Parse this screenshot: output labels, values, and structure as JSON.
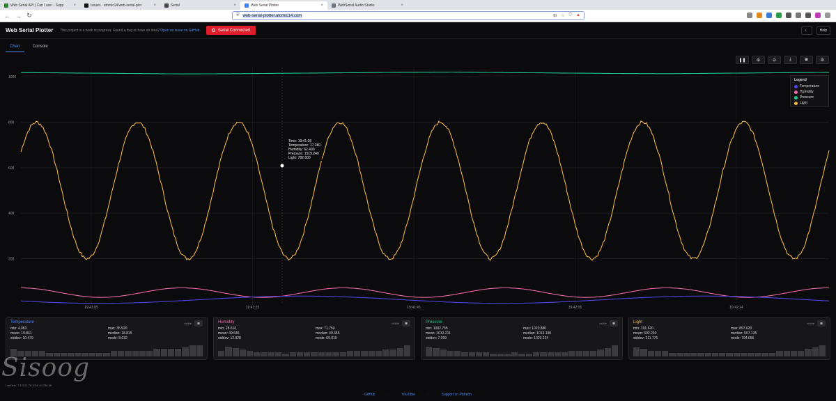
{
  "browser": {
    "tabs": [
      {
        "label": "Web Serial API | Can I use... Supp"
      },
      {
        "label": "Issues · atomic14/web-serial-plot"
      },
      {
        "label": "Serial"
      },
      {
        "label": "Web Serial Plotter",
        "active": true
      },
      {
        "label": "WebSerial Audio Studio"
      }
    ],
    "url": "web-serial-plotter.atomic14.com"
  },
  "header": {
    "title": "Web Serial Plotter",
    "notice": "This project is a work in progress. Found a bug or have an idea?",
    "notice_link": "Open an issue on GitHub.",
    "serial_button": "Serial Connected",
    "help_button": "Help"
  },
  "view_tabs": [
    "Chart",
    "Console"
  ],
  "chart_toolbar_icons": [
    "pause-icon",
    "zoom-in-icon",
    "zoom-out-icon",
    "download-icon",
    "camera-icon",
    "settings-icon"
  ],
  "tooltip": {
    "time": "Time: 19:41:28",
    "temperature": "Temperature: 17.380",
    "humidity": "Humidity: 62.490",
    "pressure": "Pressure: 1519.240",
    "light": "Light: 782.600"
  },
  "legend": {
    "title": "Legend",
    "items": [
      {
        "name": "Temperature",
        "color": "#4f46e5"
      },
      {
        "name": "Humidity",
        "color": "#ec6aa8"
      },
      {
        "name": "Pressure",
        "color": "#22c58b"
      },
      {
        "name": "Light",
        "color": "#f0b44a"
      }
    ]
  },
  "chart_data": {
    "type": "line",
    "x_ticks": [
      "19:41:05",
      "19:41:25",
      "19:41:45",
      "19:42:05",
      "19:42:24"
    ],
    "y_ticks": [
      "1000",
      "800",
      "600",
      "400",
      "200"
    ],
    "ylim": [
      0,
      1040
    ],
    "grid": true,
    "legend_position": "top-right",
    "series": [
      {
        "name": "Light",
        "color": "#f0b44a",
        "shape": "sine",
        "min": 200,
        "max": 800,
        "cycles": 8,
        "phase": 0.6
      },
      {
        "name": "Pressure",
        "color": "#22c58b",
        "shape": "drift",
        "values": [
          1018,
          1016,
          1014,
          1012,
          1013,
          1015,
          1017,
          1019,
          1020,
          1018,
          1016,
          1014,
          1013,
          1015,
          1017,
          1019
        ]
      },
      {
        "name": "Humidity",
        "color": "#ec6aa8",
        "shape": "sine",
        "min": 30,
        "max": 72,
        "cycles": 5,
        "phase": 1.6
      },
      {
        "name": "Temperature",
        "color": "#4f46e5",
        "shape": "sine",
        "min": 4,
        "max": 36,
        "cycles": 2,
        "phase": 3.5
      }
    ]
  },
  "cards": [
    {
      "name": "Temperature",
      "color": "#4f7ef7",
      "mode": "visible",
      "stats": [
        "min: 4.083",
        "max: 35.920",
        "mean: 19.841",
        "median: 18.815",
        "stddev: 10.479",
        "mode: 8.032"
      ],
      "bars": [
        4,
        3,
        3,
        3,
        3,
        2,
        2,
        2,
        2,
        2,
        2,
        2,
        2,
        2,
        3,
        3,
        3,
        3,
        3,
        3,
        4,
        4,
        4,
        4,
        5,
        6,
        6
      ]
    },
    {
      "name": "Humidity",
      "color": "#ec6aa8",
      "mode": "visible",
      "stats": [
        "min: 28.610",
        "max: 71.750",
        "mean: 49.646",
        "median: 49.355",
        "stddev: 12.928",
        "mode: 69.019"
      ],
      "bars": [
        4,
        7,
        6,
        5,
        4,
        3,
        3,
        3,
        3,
        2,
        3,
        3,
        3,
        3,
        3,
        3,
        3,
        3,
        4,
        4,
        4,
        4,
        4,
        5,
        5,
        6,
        8
      ]
    },
    {
      "name": "Pressure",
      "color": "#22c58b",
      "mode": "visible",
      "stats": [
        "min: 1002.755",
        "max: 1023.880",
        "mean: 1013.211",
        "median: 1013.190",
        "stddev: 7.099",
        "mode: 1023.224"
      ],
      "bars": [
        7,
        6,
        5,
        4,
        4,
        3,
        3,
        3,
        3,
        2,
        2,
        2,
        3,
        2,
        2,
        3,
        3,
        3,
        3,
        3,
        4,
        4,
        4,
        4,
        5,
        6,
        8
      ]
    },
    {
      "name": "Light",
      "color": "#f0b44a",
      "mode": "visible",
      "stats": [
        "min: 191.620",
        "max: 897.620",
        "mean: 502.230",
        "median: 507.135",
        "stddev: 211.776",
        "mode: 794.056"
      ],
      "bars": [
        5,
        4,
        3,
        3,
        3,
        2,
        2,
        2,
        2,
        2,
        2,
        2,
        2,
        2,
        2,
        2,
        2,
        2,
        2,
        2,
        3,
        3,
        3,
        3,
        4,
        5,
        6
      ]
    }
  ],
  "last_line": "Last line: 7.5 3.21 76.1016 40.236.66",
  "watermark": "Sisoog",
  "footer": [
    "GitHub",
    "YouTube",
    "Support on Patreon"
  ]
}
